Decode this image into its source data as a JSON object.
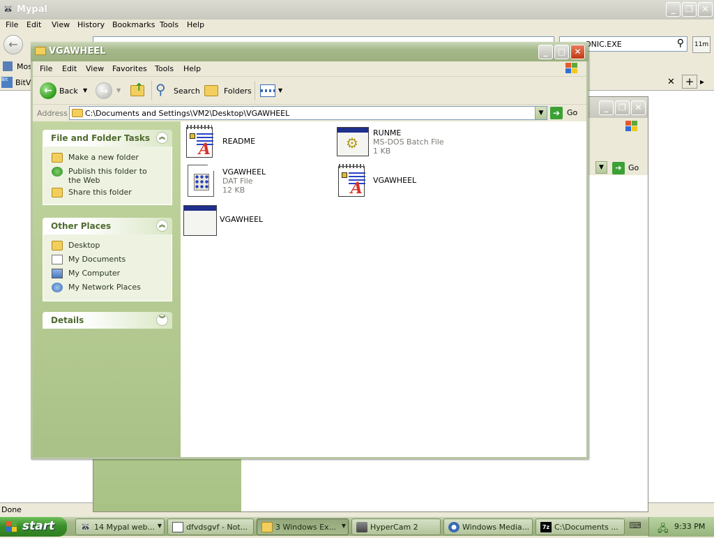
{
  "browser": {
    "title": "Mypal",
    "menu": [
      "File",
      "Edit",
      "View",
      "History",
      "Bookmarks",
      "Tools",
      "Help"
    ],
    "search_value": "ONIC.EXE",
    "small_badge": "11m",
    "bookmark_partial": "Most",
    "tab_partial": "BitVi",
    "status": "Done"
  },
  "explorer": {
    "title": "VGAWHEEL",
    "menu": [
      "File",
      "Edit",
      "View",
      "Favorites",
      "Tools",
      "Help"
    ],
    "toolbar": {
      "back": "Back",
      "search": "Search",
      "folders": "Folders"
    },
    "address_label": "Address",
    "address_path": "C:\\Documents and Settings\\VM2\\Desktop\\VGAWHEEL",
    "go_label": "Go",
    "file_tasks": {
      "header": "File and Folder Tasks",
      "items": [
        "Make a new folder",
        "Publish this folder to the Web",
        "Share this folder"
      ]
    },
    "other_places": {
      "header": "Other Places",
      "items": [
        "Desktop",
        "My Documents",
        "My Computer",
        "My Network Places"
      ]
    },
    "details": {
      "header": "Details"
    },
    "files": [
      {
        "name": "README",
        "type": "",
        "size": "",
        "icon": "text-document-icon"
      },
      {
        "name": "RUNME",
        "type": "MS-DOS Batch File",
        "size": "1 KB",
        "icon": "batch-file-icon"
      },
      {
        "name": "VGAWHEEL",
        "type": "DAT File",
        "size": "12 KB",
        "icon": "dat-file-icon"
      },
      {
        "name": "VGAWHEEL",
        "type": "",
        "size": "",
        "icon": "text-document-icon"
      },
      {
        "name": "VGAWHEEL",
        "type": "",
        "size": "",
        "icon": "application-icon"
      }
    ]
  },
  "background_window": {
    "go_label": "Go"
  },
  "taskbar": {
    "start": "start",
    "tasks": [
      {
        "label": "14 Mypal web...",
        "active": false
      },
      {
        "label": "dfvdsgvf - Not...",
        "active": false
      },
      {
        "label": "3 Windows Ex...",
        "active": true
      },
      {
        "label": "HyperCam 2",
        "active": false
      },
      {
        "label": "Windows Media...",
        "active": false
      },
      {
        "label": "C:\\Documents ...",
        "active": false
      }
    ],
    "clock": "9:33 PM"
  }
}
